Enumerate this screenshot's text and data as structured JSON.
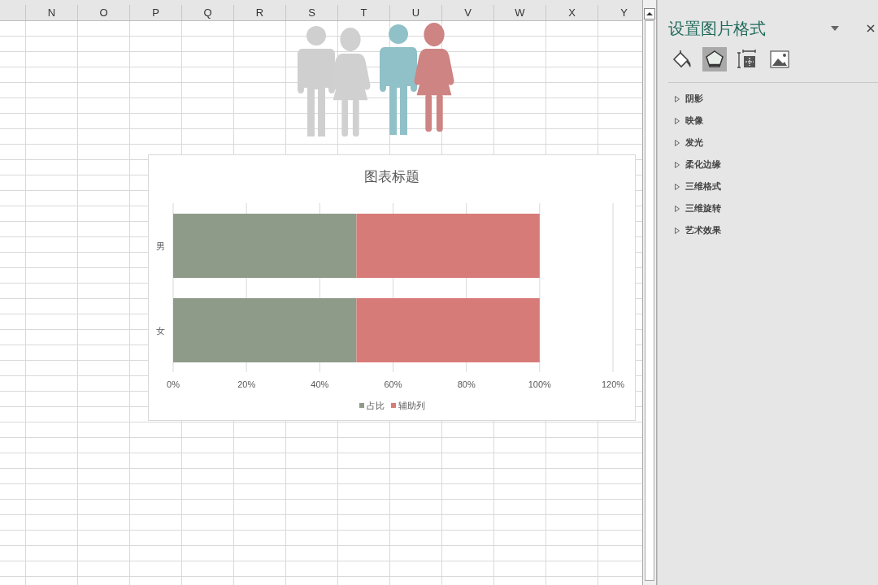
{
  "sheet": {
    "columns": [
      "N",
      "O",
      "P",
      "Q",
      "R",
      "S",
      "T",
      "U",
      "V",
      "W",
      "X",
      "Y"
    ],
    "chart": {
      "chart_data": {
        "type": "bar",
        "orientation": "horizontal",
        "stacked": true,
        "grid": true,
        "legend": "bottom",
        "title": "图表标题",
        "categories": [
          "男",
          "女"
        ],
        "series": [
          {
            "name": "占比",
            "color": "#8e9b88",
            "values": [
              0.5,
              0.5
            ]
          },
          {
            "name": "辅助列",
            "color": "#d77b79",
            "values": [
              0.5,
              0.5
            ]
          }
        ],
        "xlim": [
          0,
          1.2
        ],
        "xticks": [
          {
            "value": 0,
            "label": "0%"
          },
          {
            "value": 0.2,
            "label": "20%"
          },
          {
            "value": 0.4,
            "label": "40%"
          },
          {
            "value": 0.6,
            "label": "60%"
          },
          {
            "value": 0.8,
            "label": "80%"
          },
          {
            "value": 1,
            "label": "100%"
          },
          {
            "value": 1.2,
            "label": "120%"
          }
        ]
      }
    }
  },
  "panel": {
    "title": "设置图片格式",
    "tabs": [
      {
        "kind": "fill",
        "selected": false
      },
      {
        "kind": "effects",
        "selected": true
      },
      {
        "kind": "size",
        "selected": false
      },
      {
        "kind": "picture",
        "selected": false
      }
    ],
    "sections": [
      {
        "label": "阴影",
        "expanded": false
      },
      {
        "label": "映像",
        "expanded": false
      },
      {
        "label": "发光",
        "expanded": false
      },
      {
        "label": "柔化边缘",
        "expanded": false
      },
      {
        "label": "三维格式",
        "expanded": false
      },
      {
        "label": "三维旋转",
        "expanded": false
      },
      {
        "label": "艺术效果",
        "expanded": false
      }
    ]
  }
}
